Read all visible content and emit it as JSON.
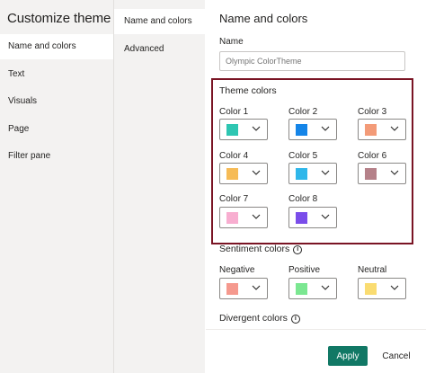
{
  "dialog_title": "Customize theme",
  "nav": {
    "items": [
      {
        "label": "Name and colors",
        "active": true
      },
      {
        "label": "Text",
        "active": false
      },
      {
        "label": "Visuals",
        "active": false
      },
      {
        "label": "Page",
        "active": false
      },
      {
        "label": "Filter pane",
        "active": false
      }
    ]
  },
  "subnav": {
    "items": [
      {
        "label": "Name and colors",
        "active": true
      },
      {
        "label": "Advanced",
        "active": false
      }
    ]
  },
  "pane": {
    "title": "Name and colors",
    "name_label": "Name",
    "name_placeholder": "Olympic ColorTheme",
    "theme_colors_label": "Theme colors",
    "theme_colors": [
      {
        "label": "Color 1",
        "color": "#2ec6b2"
      },
      {
        "label": "Color 2",
        "color": "#1585e8"
      },
      {
        "label": "Color 3",
        "color": "#f39b78"
      },
      {
        "label": "Color 4",
        "color": "#f6bb56"
      },
      {
        "label": "Color 5",
        "color": "#2fb7ea"
      },
      {
        "label": "Color 6",
        "color": "#b58189"
      },
      {
        "label": "Color 7",
        "color": "#f8aed0"
      },
      {
        "label": "Color 8",
        "color": "#7a4dea"
      }
    ],
    "sentiment_label": "Sentiment colors",
    "sentiment_colors": [
      {
        "label": "Negative",
        "color": "#f5998e"
      },
      {
        "label": "Positive",
        "color": "#7be791"
      },
      {
        "label": "Neutral",
        "color": "#fadc71"
      }
    ],
    "divergent_label": "Divergent colors",
    "info_glyph": "i"
  },
  "footer": {
    "apply_label": "Apply",
    "cancel_label": "Cancel",
    "apply_color": "#117865"
  },
  "accent_border_color": "#7a1424"
}
